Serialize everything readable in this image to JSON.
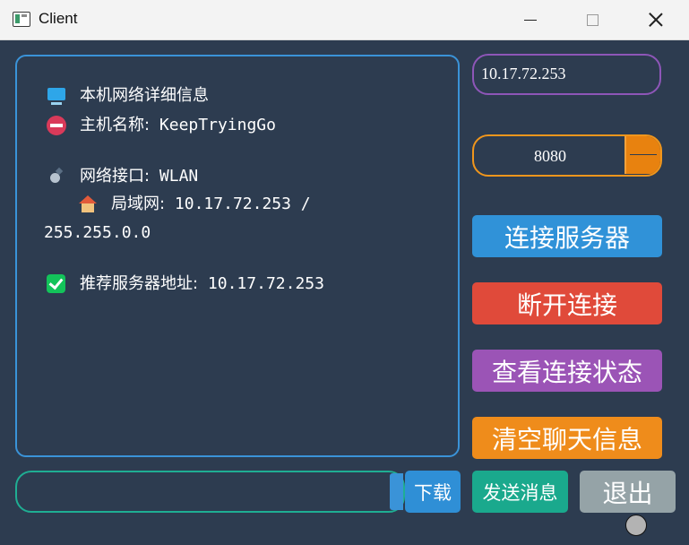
{
  "window": {
    "title": "Client",
    "icon": "app-window-icon",
    "controls": [
      "minimize-icon",
      "maximize-icon",
      "close-icon"
    ]
  },
  "info": {
    "line1_label": "本机网络详细信息",
    "line2_label": "主机名称:",
    "line2_value": "KeepTryingGo",
    "line3_label": "网络接口:",
    "line3_value": "WLAN",
    "line4_label": "局域网:",
    "line4_value": "10.17.72.253 /",
    "line5_value": "255.255.0.0",
    "line6_label": "推荐服务器地址:",
    "line6_value": "10.17.72.253"
  },
  "server": {
    "ip": "10.17.72.253",
    "port": "8080"
  },
  "buttons": {
    "connect": "连接服务器",
    "disconnect": "断开连接",
    "status": "查看连接状态",
    "clear": "清空聊天信息",
    "download": "下载",
    "send": "发送消息",
    "exit": "退出"
  },
  "message": {
    "value": ""
  },
  "colors": {
    "background": "#2d3c50",
    "info_border": "#3a93d8",
    "ip_border": "#8e56b8",
    "port_border": "#f0961c",
    "connect": "#3092d8",
    "disconnect": "#e04a3a",
    "status": "#9b54b6",
    "clear": "#ef8c1b",
    "send": "#1aa98d",
    "exit": "#95a3a7",
    "input_border": "#1fae93"
  }
}
